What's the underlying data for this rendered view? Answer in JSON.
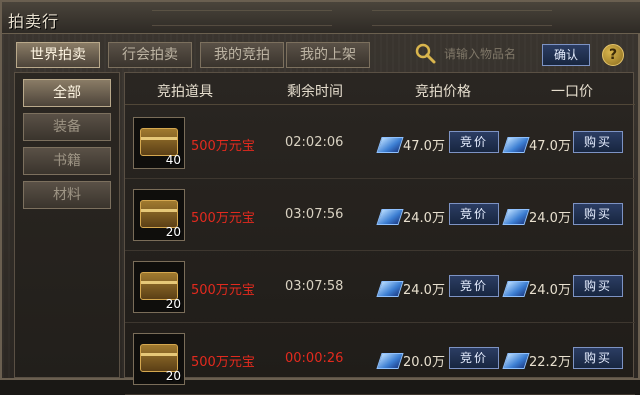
{
  "window": {
    "title": "拍卖行"
  },
  "tabs": [
    {
      "label": "世界拍卖",
      "active": true
    },
    {
      "label": "行会拍卖",
      "active": false
    },
    {
      "label": "我的竞拍",
      "active": false
    },
    {
      "label": "我的上架",
      "active": false
    }
  ],
  "search": {
    "placeholder": "请输入物品名",
    "confirm_label": "确认",
    "help_label": "?"
  },
  "sidebar": {
    "categories": [
      {
        "label": "全部",
        "active": true
      },
      {
        "label": "装备",
        "active": false
      },
      {
        "label": "书籍",
        "active": false
      },
      {
        "label": "材料",
        "active": false
      }
    ]
  },
  "table": {
    "headers": [
      "竞拍道具",
      "剩余时间",
      "竞拍价格",
      "一口价"
    ],
    "rows": [
      {
        "icon": "treasure-chest-icon",
        "qty": "40",
        "name": "500万元宝",
        "time": "02:02:06",
        "urgent": false,
        "bid": "47.0万",
        "bid_btn": "竞价",
        "buyout": "47.0万",
        "buy_btn": "购买"
      },
      {
        "icon": "treasure-chest-icon",
        "qty": "20",
        "name": "500万元宝",
        "time": "03:07:56",
        "urgent": false,
        "bid": "24.0万",
        "bid_btn": "竞价",
        "buyout": "24.0万",
        "buy_btn": "购买"
      },
      {
        "icon": "treasure-chest-icon",
        "qty": "20",
        "name": "500万元宝",
        "time": "03:07:58",
        "urgent": false,
        "bid": "24.0万",
        "bid_btn": "竞价",
        "buyout": "24.0万",
        "buy_btn": "购买"
      },
      {
        "icon": "treasure-chest-icon",
        "qty": "20",
        "name": "500万元宝",
        "time": "00:00:26",
        "urgent": true,
        "bid": "20.0万",
        "bid_btn": "竞价",
        "buyout": "22.2万",
        "buy_btn": "购买"
      }
    ]
  },
  "colors": {
    "item_name": "#e32a1e",
    "urgent_time": "#e32a1e",
    "button_blue": "#182640"
  }
}
